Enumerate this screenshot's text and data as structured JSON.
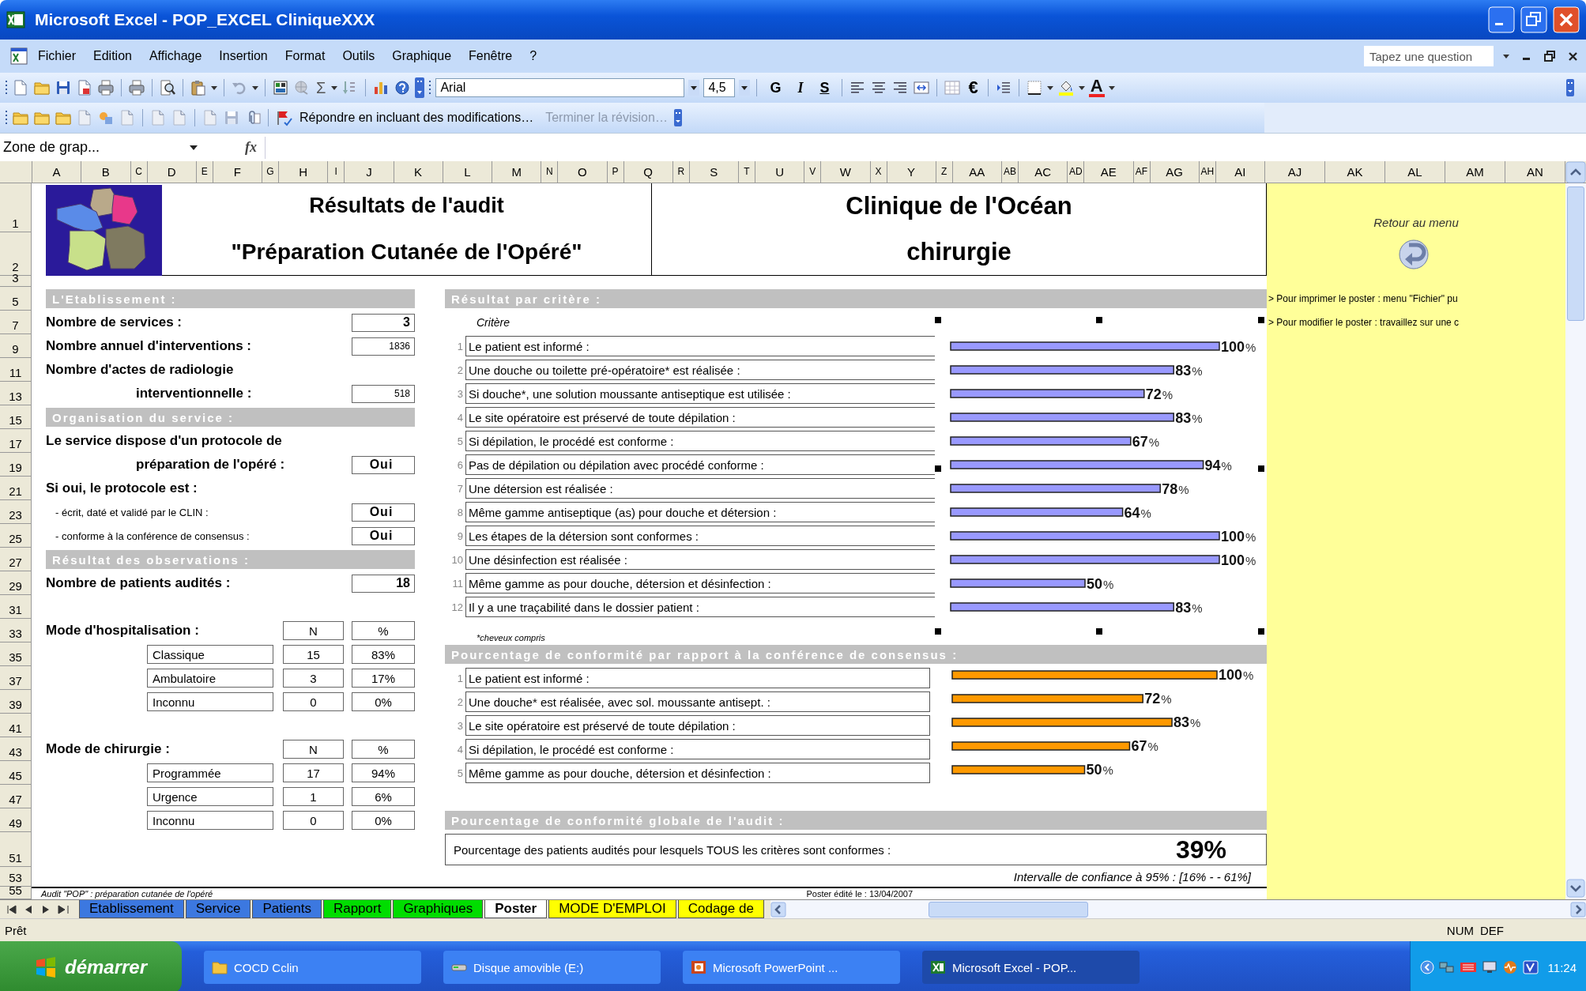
{
  "window": {
    "title": "Microsoft Excel - POP_EXCEL CliniqueXXX"
  },
  "menu_bar": {
    "items": [
      "Fichier",
      "Edition",
      "Affichage",
      "Insertion",
      "Format",
      "Outils",
      "Graphique",
      "Fenêtre",
      "?"
    ],
    "question_field": {
      "placeholder": "Tapez une question"
    }
  },
  "standard_toolbar": {
    "autosum": "Σ"
  },
  "formatting_toolbar": {
    "font": "Arial",
    "size": "4,5",
    "style_buttons": [
      "G",
      "I",
      "S"
    ],
    "currency": "€",
    "font_color_letter": "A"
  },
  "review_toolbar": {
    "reply": "Répondre en incluant des modifications…",
    "end_review": {
      "label": "Terminer la révision…",
      "disabled": true
    }
  },
  "formula_bar": {
    "name_box": "Zone de grap...",
    "fx": "fx"
  },
  "column_headers": [
    "A",
    "B",
    "C",
    "D",
    "E",
    "F",
    "G",
    "H",
    "I",
    "J",
    "K",
    "L",
    "M",
    "N",
    "O",
    "P",
    "Q",
    "R",
    "S",
    "T",
    "U",
    "V",
    "W",
    "X",
    "Y",
    "Z",
    "AA",
    "AB",
    "AC",
    "AD",
    "AE",
    "AF",
    "AG",
    "AH",
    "AI",
    "AJ",
    "AK",
    "AL",
    "AM",
    "AN"
  ],
  "row_headers": [
    "1",
    "2",
    "3",
    "5",
    "7",
    "9",
    "11",
    "13",
    "15",
    "17",
    "19",
    "21",
    "23",
    "25",
    "27",
    "29",
    "31",
    "33",
    "35",
    "37",
    "39",
    "41",
    "43",
    "45",
    "47",
    "49",
    "51",
    "53",
    "55"
  ],
  "poster": {
    "title_lines": [
      "Résultats de l'audit",
      "\"Préparation Cutanée de l'Opéré\""
    ],
    "clinic_lines": [
      "Clinique de l'Océan",
      "chirurgie"
    ],
    "left_panel": [
      {
        "kind": "section",
        "label": "L'Etablissement :"
      },
      {
        "kind": "field",
        "label": "Nombre de services :",
        "value": "3"
      },
      {
        "kind": "count",
        "label": "Nombre annuel d'interventions :",
        "value": "1836"
      },
      {
        "kind": "text",
        "label": "Nombre d'actes de radiologie"
      },
      {
        "kind": "count_indented",
        "label": "interventionnelle :",
        "value": "518"
      },
      {
        "kind": "section",
        "label": "Organisation du service :"
      },
      {
        "kind": "text",
        "label": "Le service dispose d'un protocole de"
      },
      {
        "kind": "field_indented",
        "label": "préparation de l'opéré :",
        "value": "Oui"
      },
      {
        "kind": "text",
        "label": "Si oui, le protocole est :"
      },
      {
        "kind": "sub_field",
        "label": "- écrit, daté et validé par le CLIN :",
        "value": "Oui"
      },
      {
        "kind": "sub_field",
        "label": "- conforme à la conférence de consensus :",
        "value": "Oui"
      },
      {
        "kind": "section",
        "label": "Résultat des observations :"
      },
      {
        "kind": "field",
        "label": "Nombre de patients audités :",
        "value": "18"
      },
      {
        "kind": "spacer"
      },
      {
        "kind": "table_head",
        "label": "Mode d'hospitalisation :",
        "n": "N",
        "percent": "%"
      },
      {
        "kind": "table_row",
        "label": "Classique",
        "n": "15",
        "percent": "83%"
      },
      {
        "kind": "table_row",
        "label": "Ambulatoire",
        "n": "3",
        "percent": "17%"
      },
      {
        "kind": "table_row",
        "label": "Inconnu",
        "n": "0",
        "percent": "0%"
      },
      {
        "kind": "spacer"
      },
      {
        "kind": "table_head",
        "label": "Mode de chirurgie :",
        "n": "N",
        "percent": "%"
      },
      {
        "kind": "table_row",
        "label": "Programmée",
        "n": "17",
        "percent": "94%"
      },
      {
        "kind": "table_row",
        "label": "Urgence",
        "n": "1",
        "percent": "6%"
      },
      {
        "kind": "table_row",
        "label": "Inconnu",
        "n": "0",
        "percent": "0%"
      }
    ],
    "criteria_section": {
      "heading": "Résultat par critère :",
      "column_label": "Critère",
      "criteria": [
        {
          "number": "1",
          "label": "Le patient est informé :"
        },
        {
          "number": "2",
          "label": "Une douche ou toilette pré-opératoire* est réalisée :"
        },
        {
          "number": "3",
          "label": "Si douche*, une solution moussante antiseptique est utilisée :"
        },
        {
          "number": "4",
          "label": "Le site opératoire est préservé de toute dépilation :"
        },
        {
          "number": "5",
          "label": "Si dépilation, le procédé est conforme :"
        },
        {
          "number": "6",
          "label": "Pas de dépilation ou dépilation avec procédé conforme :"
        },
        {
          "number": "7",
          "label": "Une détersion est réalisée :"
        },
        {
          "number": "8",
          "label": "Même gamme antiseptique (as) pour douche et détersion :"
        },
        {
          "number": "9",
          "label": "Les étapes de la détersion sont conformes :"
        },
        {
          "number": "10",
          "label": "Une désinfection est réalisée :"
        },
        {
          "number": "11",
          "label": "Même gamme as pour douche, détersion et désinfection :"
        },
        {
          "number": "12",
          "label": "Il y a une traçabilité dans le dossier patient :"
        }
      ],
      "footnote": "*cheveux compris",
      "chart_data": {
        "type": "bar",
        "orientation": "horizontal",
        "data_labels": true,
        "series": [
          {
            "color": "#9999ff",
            "values": [
              100,
              83,
              72,
              83,
              67,
              94,
              78,
              64,
              100,
              100,
              50,
              83
            ]
          }
        ]
      }
    },
    "consensus_section": {
      "heading": "Pourcentage de conformité par rapport à la conférence de consensus :",
      "criteria": [
        {
          "number": "1",
          "label": "Le patient est informé :"
        },
        {
          "number": "2",
          "label": "Une douche* est réalisée, avec sol. moussante antisept. :"
        },
        {
          "number": "3",
          "label": "Le site opératoire est préservé de toute dépilation :"
        },
        {
          "number": "4",
          "label": "Si dépilation, le procédé est conforme :"
        },
        {
          "number": "5",
          "label": "Même gamme as pour douche, détersion et désinfection :"
        }
      ],
      "chart_data": {
        "type": "bar",
        "orientation": "horizontal",
        "data_labels": true,
        "series": [
          {
            "color": "#ff9900",
            "values": [
              100,
              72,
              83,
              67,
              50
            ]
          }
        ]
      }
    },
    "global_section": {
      "heading": "Pourcentage de conformité globale de l'audit :",
      "sentence": "Pourcentage des patients audités pour lesquels TOUS les critères sont conformes :",
      "value": "39%",
      "interval": "Intervalle de confiance à 95% : [16% - - 61%]"
    },
    "footer": {
      "left": "Audit \"POP\" : préparation cutanée de l'opéré",
      "right": "Poster édité le : 13/04/2007"
    }
  },
  "side_panel": {
    "link": "Retour au menu",
    "notes": [
      "> Pour imprimer le poster : menu \"Fichier\" pu",
      "> Pour modifier le poster : travaillez sur une c"
    ]
  },
  "sheet_tabs": [
    {
      "label": "Etablissement",
      "color": "#3c78e0",
      "selected": false
    },
    {
      "label": "Service",
      "color": "#3c78e0",
      "selected": false
    },
    {
      "label": "Patients",
      "color": "#3c78e0",
      "selected": false
    },
    {
      "label": "Rapport",
      "color": "#00dd00",
      "selected": false
    },
    {
      "label": "Graphiques",
      "color": "#00dd00",
      "selected": false
    },
    {
      "label": "Poster",
      "color": "#ffffff",
      "selected": true
    },
    {
      "label": "MODE D'EMPLOI",
      "color": "#ffff00",
      "selected": false
    },
    {
      "label": "Codage de",
      "color": "#ffff00",
      "selected": false
    }
  ],
  "status_bar": {
    "text": "Prêt",
    "indicators": [
      "NUM",
      "DEF"
    ]
  },
  "taskbar": {
    "start": "démarrer",
    "tasks": [
      {
        "label": "COCD Cclin",
        "selected": false
      },
      {
        "label": "Disque amovible (E:)",
        "selected": false
      },
      {
        "label": "Microsoft PowerPoint ...",
        "selected": false
      },
      {
        "label": "Microsoft Excel - POP...",
        "selected": true
      }
    ],
    "clock": "11:24"
  }
}
